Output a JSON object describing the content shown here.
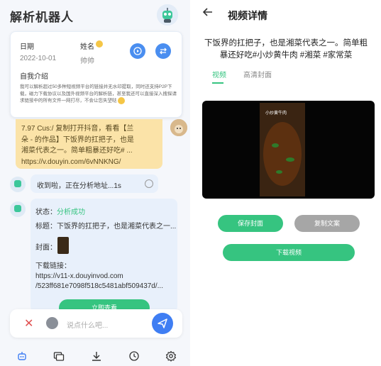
{
  "left": {
    "app_title": "解析机器人",
    "profile": {
      "date_label": "日期",
      "date_value": "2022-10-01",
      "name_label": "姓名",
      "name_value": "帅帅",
      "intro_title": "自我介绍",
      "intro_text": "我可以解析超过50多种短视频平台的链接并无水印提取，同时还支持P2P下载，磁力下载协议以及国外视频平台的解析链，甚至我还可以直接深入搜探请求链接中的所有文件一网打尽，不会让您失望哒"
    },
    "user_message": {
      "lines": [
        "7.97 Cus:/ 复制打开抖音，看看【兰",
        "朵 - 的作品】下饭界的扛把子，也是",
        "湘菜代表之一。简单粗暴还好吃# ...",
        "https://v.douyin.com/6vNNKNG/"
      ]
    },
    "bot_status": "收到啦，正在分析地址...1s",
    "result": {
      "status_label": "状态：",
      "status_value": "分析成功",
      "title_label": "标题：",
      "title_value": "下饭界的扛把子，也是湘菜代表之一...",
      "cover_label": "封面：",
      "download_label": "下载链接：",
      "link_line1": "https://v11-x.douyinvod.com",
      "link_line2": "/523ff681e7098f518c5481abf509437d/...",
      "view_button": "立即查看"
    },
    "input_placeholder": "说点什么吧...",
    "tabs": [
      "robot-icon",
      "media-icon",
      "download-icon",
      "history-icon",
      "settings-icon"
    ]
  },
  "right": {
    "title": "视频详情",
    "description": "下饭界的扛把子，也是湘菜代表之一。简单粗暴还好吃#小炒黄牛肉 #湘菜 #家常菜",
    "tab_video": "视频",
    "tab_cover": "高清封面",
    "video_caption": "小炒黄牛肉",
    "save_cover": "保存封面",
    "copy_text": "复制文案",
    "download_video": "下载视频"
  },
  "colors": {
    "accent_green": "#36c480",
    "accent_blue": "#3f7ef3",
    "bubble_yellow": "#fbe3a8",
    "bubble_blue": "#e8f0fb"
  }
}
